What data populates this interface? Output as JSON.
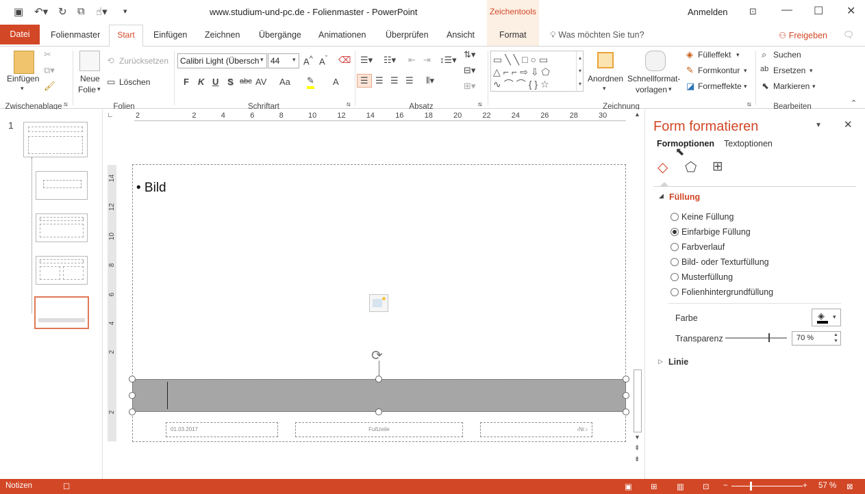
{
  "window": {
    "title": "www.studium-und-pc.de - Folienmaster - PowerPoint",
    "context_group": "Zeichentools",
    "signin": "Anmelden"
  },
  "tabs": {
    "datei": "Datei",
    "folienmaster": "Folienmaster",
    "start": "Start",
    "einfuegen": "Einfügen",
    "zeichnen": "Zeichnen",
    "uebergaenge": "Übergänge",
    "animationen": "Animationen",
    "ueberpruefen": "Überprüfen",
    "ansicht": "Ansicht",
    "format": "Format",
    "tellme": "Was möchten Sie tun?",
    "share": "Freigeben"
  },
  "ribbon": {
    "clipboard": {
      "label": "Zwischenablage",
      "paste": "Einfügen"
    },
    "slides": {
      "label": "Folien",
      "new": "Neue",
      "new2": "Folie",
      "reset": "Zurücksetzen",
      "delete": "Löschen"
    },
    "font": {
      "label": "Schriftart",
      "name": "Calibri Light (Übersch",
      "size": "44",
      "bold": "F",
      "italic": "K",
      "underline": "U",
      "shadow": "S",
      "strike": "abc",
      "spacing": "AV",
      "case": "Aa",
      "color": "A"
    },
    "paragraph": {
      "label": "Absatz"
    },
    "drawing": {
      "label": "Zeichnung",
      "arrange": "Anordnen",
      "quickstyles": "Schnellformat-",
      "quickstyles2": "vorlagen",
      "fill": "Fülleffekt",
      "outline": "Formkontur",
      "effects": "Formeffekte"
    },
    "editing": {
      "label": "Bearbeiten",
      "find": "Suchen",
      "replace": "Ersetzen",
      "select": "Markieren"
    }
  },
  "thumbnails": {
    "number": "1"
  },
  "ruler": {
    "h": [
      "2",
      "2",
      "4",
      "6",
      "8",
      "10",
      "12",
      "14",
      "16",
      "18",
      "20",
      "22",
      "24",
      "26",
      "28",
      "30"
    ],
    "v": [
      "14",
      "12",
      "10",
      "8",
      "6",
      "4",
      "2",
      "2"
    ]
  },
  "slide": {
    "bullet": "• Bild",
    "date": "01.03.2017",
    "footer": "Fußzeile",
    "number": "‹Nr.›"
  },
  "pane": {
    "title": "Form formatieren",
    "tab1": "Formoptionen",
    "tab2": "Textoptionen",
    "section": "Füllung",
    "options": [
      "Keine Füllung",
      "Einfarbige Füllung",
      "Farbverlauf",
      "Bild- oder Texturfüllung",
      "Musterfüllung",
      "Folienhintergrundfüllung"
    ],
    "selected_index": 1,
    "color_label": "Farbe",
    "transparency_label": "Transparenz",
    "transparency_value": "70 %",
    "transparency_fraction": 0.7,
    "line_section": "Linie"
  },
  "status": {
    "notes": "Notizen",
    "zoom": "57 %",
    "zoom_fraction": 0.57
  }
}
